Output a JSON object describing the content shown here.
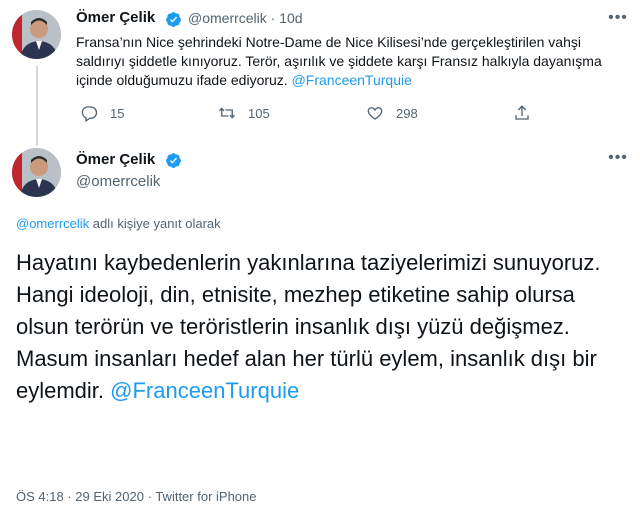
{
  "tweet1": {
    "name": "Ömer Çelik",
    "handle": "@omerrcelik",
    "separator": "·",
    "age": "10d",
    "text_part1": "Fransa’nın Nice şehrindeki Notre-Dame de Nice Kilisesi’nde gerçekleştirilen vahşi saldırıyı şiddetle kınıyoruz. Terör, aşırılık ve şiddete karşı Fransız halkıyla dayanışma içinde olduğumuzu ifade ediyoruz. ",
    "mention": "@FranceenTurquie",
    "reply_count": "15",
    "retweet_count": "105",
    "like_count": "298"
  },
  "tweet2": {
    "name": "Ömer Çelik",
    "handle": "@omerrcelik",
    "replying_mention": "@omerrcelik",
    "replying_text": " adlı kişiye yanıt olarak",
    "line1": "Hayatını kaybedenlerin yakınlarına taziyelerimizi sunuyoruz.",
    "line2": "Hangi ideoloji, din, etnisite, mezhep etiketine sahip olursa olsun terörün ve teröristlerin insanlık dışı yüzü değişmez.",
    "line3": "Masum insanları hedef alan her türlü eylem, insanlık dışı bir eylemdir. ",
    "mention": "@FranceenTurquie",
    "time": "ÖS 4:18",
    "date": "29 Eki 2020",
    "source": "Twitter for iPhone",
    "dot": "·"
  },
  "colors": {
    "accent": "#1d9bf0",
    "text": "#0f1419",
    "secondary": "#536471"
  },
  "icons": [
    "verified-badge-icon",
    "more-icon",
    "reply-icon",
    "retweet-icon",
    "like-icon",
    "share-icon"
  ]
}
